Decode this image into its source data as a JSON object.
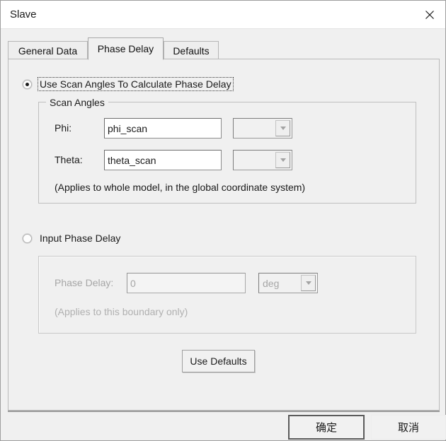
{
  "window": {
    "title": "Slave",
    "close_icon": "close-icon"
  },
  "tabs": [
    {
      "label": "General Data",
      "active": false
    },
    {
      "label": "Phase Delay",
      "active": true
    },
    {
      "label": "Defaults",
      "active": false
    }
  ],
  "scan_option": {
    "radio_label": "Use Scan Angles To Calculate Phase Delay",
    "selected": true,
    "group": {
      "title": "Scan Angles",
      "fields": [
        {
          "label": "Phi:",
          "value": "phi_scan",
          "unit_value": "",
          "unit_icon": "chevron-down-icon"
        },
        {
          "label": "Theta:",
          "value": "theta_scan",
          "unit_value": "",
          "unit_icon": "chevron-down-icon"
        }
      ],
      "note": "(Applies to whole model, in the global coordinate system)"
    }
  },
  "input_option": {
    "radio_label": "Input Phase Delay",
    "selected": false,
    "group": {
      "field": {
        "label": "Phase Delay:",
        "value": "0",
        "unit_value": "deg",
        "unit_icon": "chevron-down-icon"
      },
      "note": "(Applies to this boundary only)"
    }
  },
  "use_defaults_button": "Use Defaults",
  "footer": {
    "ok_button": "确定",
    "cancel_button": "取消"
  },
  "colors": {
    "dialog_bg": "#f0f0f0",
    "titlebar_bg": "#ffffff",
    "text": "#1a1a1a",
    "disabled_text": "#a6a6a6",
    "border": "#bfbfbf"
  }
}
